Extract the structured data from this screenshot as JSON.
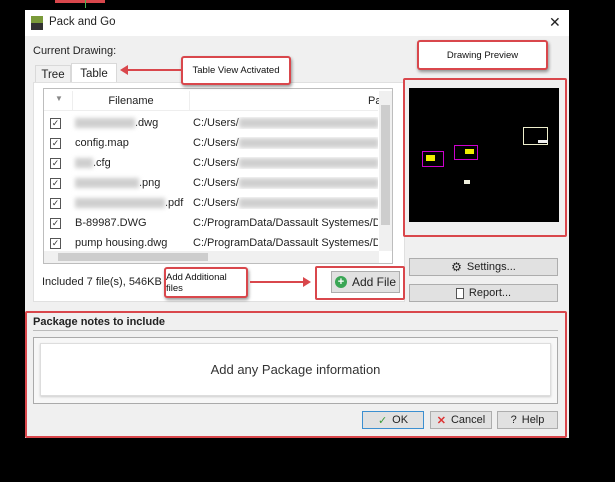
{
  "window": {
    "title": "Pack and Go",
    "close": "✕"
  },
  "current_drawing_label": "Current Drawing:",
  "tabs": [
    {
      "label": "Tree",
      "active": false
    },
    {
      "label": "Table",
      "active": true
    }
  ],
  "table": {
    "headers": [
      "Filename",
      "Pa"
    ],
    "rows": [
      {
        "filename": ".dwg",
        "path": "C:/Users/",
        "checked": true
      },
      {
        "filename": "config.map",
        "path": "C:/Users/",
        "checked": true
      },
      {
        "filename": ".cfg",
        "path": "C:/Users/",
        "checked": true
      },
      {
        "filename": ".png",
        "path": "C:/Users/",
        "checked": true
      },
      {
        "filename": ".pdf",
        "path": "C:/Users/",
        "checked": true
      },
      {
        "filename": "B-89987.DWG",
        "path": "C:/ProgramData/Dassault Systemes/DraftS",
        "checked": true
      },
      {
        "filename": "pump housing.dwg",
        "path": "C:/ProgramData/Dassault Systemes/DraftS",
        "checked": true
      }
    ]
  },
  "summary": "Included 7 file(s), 546KB",
  "buttons": {
    "add_file": "Add File",
    "settings": "Settings...",
    "report": "Report...",
    "ok": "OK",
    "cancel": "Cancel",
    "help": "Help"
  },
  "package_notes": {
    "title": "Package notes to include",
    "placeholder": "Add any Package information"
  },
  "callouts": {
    "table_view": "Table View Activated",
    "preview": "Drawing Preview",
    "add_files": "Add Additional files"
  },
  "colors": {
    "annotation": "#d9474c",
    "preview_bg": "#000000"
  }
}
